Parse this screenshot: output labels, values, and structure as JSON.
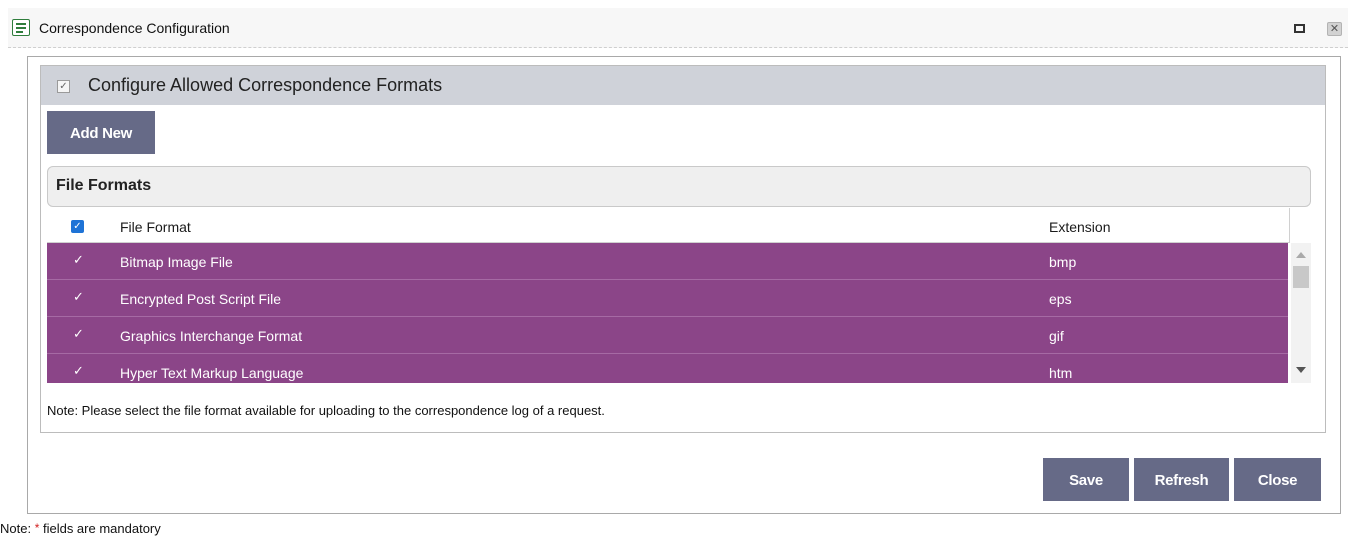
{
  "window": {
    "title": "Correspondence Configuration"
  },
  "section": {
    "checked": true,
    "label": "Configure Allowed Correspondence Formats"
  },
  "toolbar": {
    "add_new_label": "Add New"
  },
  "grid": {
    "title": "File Formats",
    "columns": [
      "File Format",
      "Extension"
    ],
    "rows": [
      {
        "format": "Bitmap Image File",
        "extension": "bmp",
        "checked": true
      },
      {
        "format": "Encrypted Post Script File",
        "extension": "eps",
        "checked": true
      },
      {
        "format": "Graphics Interchange Format",
        "extension": "gif",
        "checked": true
      },
      {
        "format": "Hyper Text Markup Language",
        "extension": "htm",
        "checked": true
      }
    ],
    "row_color": "#8b4588"
  },
  "notes": {
    "formats_note": "Note: Please select the file format available for uploading to the correspondence log of a request.",
    "mandatory_prefix": "Note: ",
    "mandatory_star": "*",
    "mandatory_suffix": " fields are mandatory"
  },
  "actions": {
    "save_label": "Save",
    "refresh_label": "Refresh",
    "close_label": "Close"
  },
  "colors": {
    "button_bg": "#666a87",
    "selected_row": "#8b4588",
    "section_header": "#cfd2d9",
    "accent_check": "#1e73d6"
  }
}
